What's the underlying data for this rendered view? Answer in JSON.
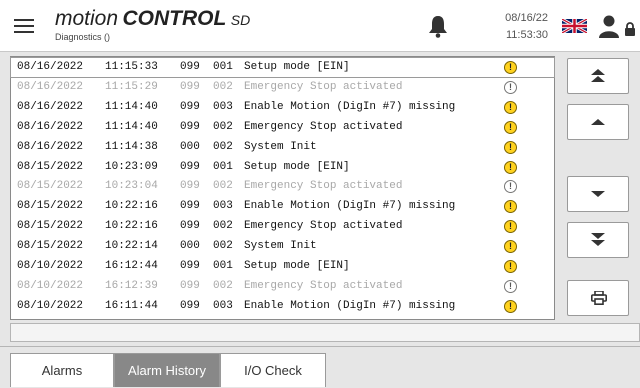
{
  "header": {
    "logo_word1": "motion",
    "logo_word2": "CONTROL",
    "logo_word3": "SD",
    "subtitle": "Diagnostics ()",
    "date": "08/16/22",
    "time": "11:53:30",
    "icons": [
      "menu-icon",
      "bell-icon",
      "uk-flag-icon",
      "user-icon",
      "lock-icon"
    ]
  },
  "log": {
    "rows": [
      {
        "date": "08/16/2022",
        "time": "11:15:33",
        "code1": "099",
        "code2": "001",
        "message": "Setup mode [EIN]",
        "dim": false,
        "selected": true
      },
      {
        "date": "08/16/2022",
        "time": "11:15:29",
        "code1": "099",
        "code2": "002",
        "message": "Emergency Stop activated",
        "dim": true,
        "selected": false
      },
      {
        "date": "08/16/2022",
        "time": "11:14:40",
        "code1": "099",
        "code2": "003",
        "message": "Enable Motion (DigIn #7) missing",
        "dim": false,
        "selected": false
      },
      {
        "date": "08/16/2022",
        "time": "11:14:40",
        "code1": "099",
        "code2": "002",
        "message": "Emergency Stop activated",
        "dim": false,
        "selected": false
      },
      {
        "date": "08/16/2022",
        "time": "11:14:38",
        "code1": "000",
        "code2": "002",
        "message": "System Init",
        "dim": false,
        "selected": false
      },
      {
        "date": "08/15/2022",
        "time": "10:23:09",
        "code1": "099",
        "code2": "001",
        "message": "Setup mode [EIN]",
        "dim": false,
        "selected": false
      },
      {
        "date": "08/15/2022",
        "time": "10:23:04",
        "code1": "099",
        "code2": "002",
        "message": "Emergency Stop activated",
        "dim": true,
        "selected": false
      },
      {
        "date": "08/15/2022",
        "time": "10:22:16",
        "code1": "099",
        "code2": "003",
        "message": "Enable Motion (DigIn #7) missing",
        "dim": false,
        "selected": false
      },
      {
        "date": "08/15/2022",
        "time": "10:22:16",
        "code1": "099",
        "code2": "002",
        "message": "Emergency Stop activated",
        "dim": false,
        "selected": false
      },
      {
        "date": "08/15/2022",
        "time": "10:22:14",
        "code1": "000",
        "code2": "002",
        "message": "System Init",
        "dim": false,
        "selected": false
      },
      {
        "date": "08/10/2022",
        "time": "16:12:44",
        "code1": "099",
        "code2": "001",
        "message": "Setup mode [EIN]",
        "dim": false,
        "selected": false
      },
      {
        "date": "08/10/2022",
        "time": "16:12:39",
        "code1": "099",
        "code2": "002",
        "message": "Emergency Stop activated",
        "dim": true,
        "selected": false
      },
      {
        "date": "08/10/2022",
        "time": "16:11:44",
        "code1": "099",
        "code2": "003",
        "message": "Enable Motion (DigIn #7) missing",
        "dim": false,
        "selected": false
      }
    ],
    "warning_icon": "!",
    "colors": {
      "warning": "#ffd21f",
      "dim_text": "#a8a8a8"
    }
  },
  "side_buttons": [
    "scroll-top-icon",
    "scroll-up-icon",
    "scroll-down-icon",
    "scroll-bottom-icon",
    "printer-icon"
  ],
  "tabs": {
    "alarms": "Alarms",
    "alarm_history": "Alarm History",
    "io_check": "I/O Check",
    "active_color": "#888888"
  }
}
